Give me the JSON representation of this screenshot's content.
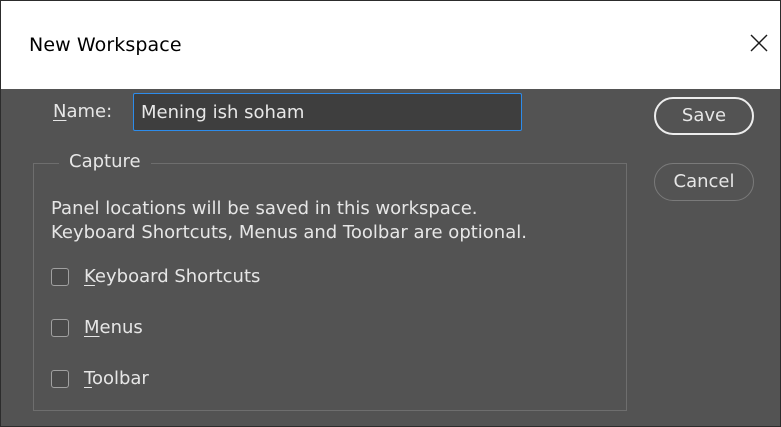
{
  "dialog": {
    "title": "New Workspace",
    "close_icon": "close-icon"
  },
  "name_field": {
    "label_mnemonic": "N",
    "label_rest": "ame:",
    "value": "Mening ish soham"
  },
  "buttons": {
    "save": "Save",
    "cancel": "Cancel"
  },
  "capture": {
    "legend": "Capture",
    "description_line1": "Panel locations will be saved in this workspace.",
    "description_line2": "Keyboard Shortcuts, Menus and Toolbar are optional.",
    "options": [
      {
        "mnemonic": "K",
        "rest": "eyboard Shortcuts",
        "checked": false
      },
      {
        "mnemonic": "M",
        "rest": "enus",
        "checked": false
      },
      {
        "mnemonic": "T",
        "rest": "oolbar",
        "checked": false
      }
    ]
  },
  "colors": {
    "background": "#535353",
    "titlebar": "#ffffff",
    "input_focus_border": "#2d8ceb",
    "text": "#e6e6e6"
  }
}
